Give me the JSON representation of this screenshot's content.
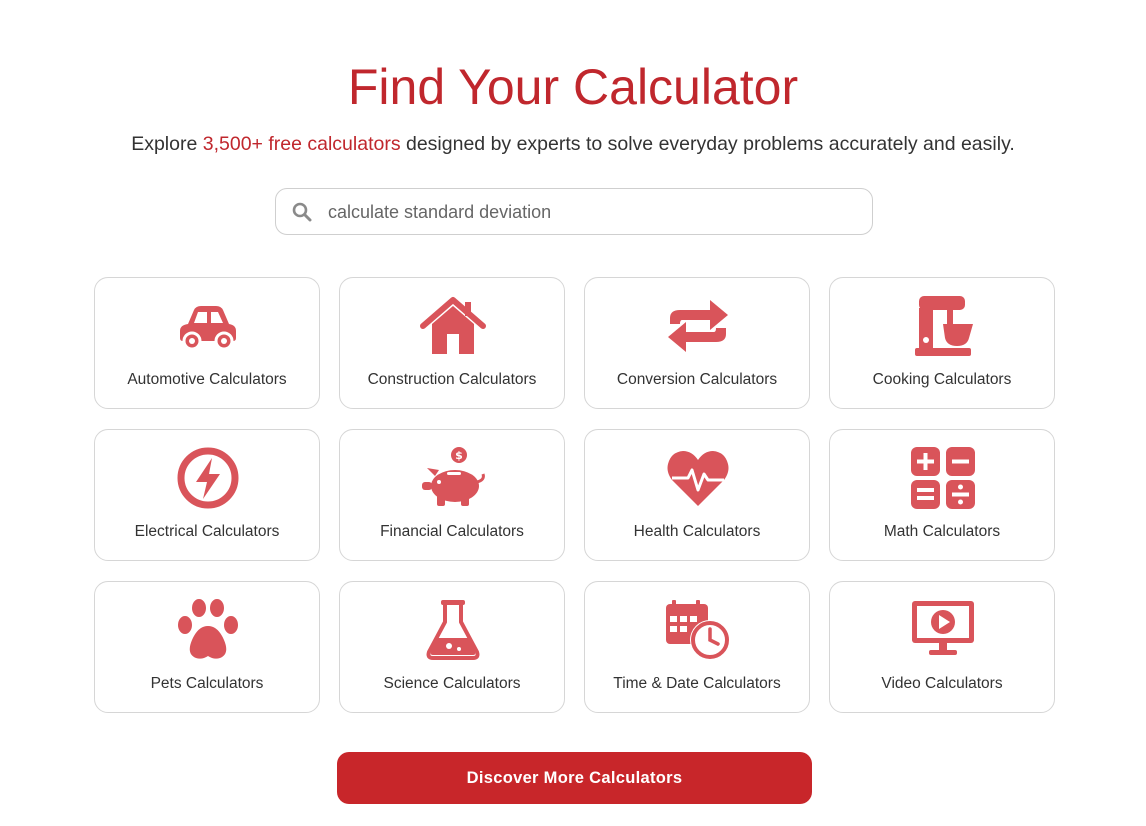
{
  "hero": {
    "title": "Find Your Calculator",
    "subtitle_prefix": "Explore ",
    "subtitle_highlight": "3,500+ free calculators",
    "subtitle_suffix": " designed by experts to solve everyday problems accurately and easily."
  },
  "search": {
    "placeholder": "calculate standard deviation",
    "icon": "search-icon"
  },
  "categories": [
    {
      "label": "Automotive Calculators",
      "icon": "car-icon"
    },
    {
      "label": "Construction Calculators",
      "icon": "house-icon"
    },
    {
      "label": "Conversion Calculators",
      "icon": "arrows-exchange-icon"
    },
    {
      "label": "Cooking Calculators",
      "icon": "stand-mixer-icon"
    },
    {
      "label": "Electrical Calculators",
      "icon": "lightning-bolt-icon"
    },
    {
      "label": "Financial Calculators",
      "icon": "piggy-bank-icon"
    },
    {
      "label": "Health Calculators",
      "icon": "heart-pulse-icon"
    },
    {
      "label": "Math Calculators",
      "icon": "math-operators-icon"
    },
    {
      "label": "Pets Calculators",
      "icon": "paw-icon"
    },
    {
      "label": "Science Calculators",
      "icon": "flask-icon"
    },
    {
      "label": "Time & Date Calculators",
      "icon": "calendar-clock-icon"
    },
    {
      "label": "Video Calculators",
      "icon": "video-monitor-icon"
    }
  ],
  "cta": {
    "label": "Discover More Calculators"
  },
  "colors": {
    "accent": "#c0272d",
    "icon": "#d9545a",
    "button": "#c8262a"
  }
}
